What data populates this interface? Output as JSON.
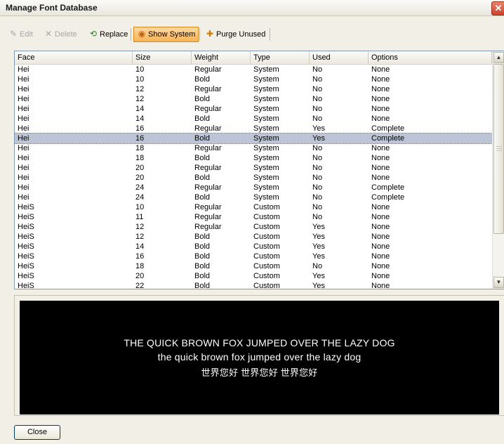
{
  "window": {
    "title": "Manage Font Database",
    "close_glyph": "✕"
  },
  "toolbar": {
    "edit": {
      "label": "Edit",
      "icon": "pencil-icon",
      "glyph": "✎"
    },
    "delete": {
      "label": "Delete",
      "icon": "x-icon",
      "glyph": "✕"
    },
    "replace": {
      "label": "Replace",
      "icon": "replace-icon",
      "glyph": "⟲"
    },
    "show_system": {
      "label": "Show System",
      "icon": "system-icon",
      "glyph": "◉"
    },
    "purge": {
      "label": "Purge Unused",
      "icon": "purge-icon",
      "glyph": "✚"
    }
  },
  "table": {
    "columns": [
      "Face",
      "Size",
      "Weight",
      "Type",
      "Used",
      "Options"
    ],
    "rows": [
      [
        "Hei",
        "10",
        "Regular",
        "System",
        "No",
        "None"
      ],
      [
        "Hei",
        "10",
        "Bold",
        "System",
        "No",
        "None"
      ],
      [
        "Hei",
        "12",
        "Regular",
        "System",
        "No",
        "None"
      ],
      [
        "Hei",
        "12",
        "Bold",
        "System",
        "No",
        "None"
      ],
      [
        "Hei",
        "14",
        "Regular",
        "System",
        "No",
        "None"
      ],
      [
        "Hei",
        "14",
        "Bold",
        "System",
        "No",
        "None"
      ],
      [
        "Hei",
        "16",
        "Regular",
        "System",
        "Yes",
        "Complete"
      ],
      [
        "Hei",
        "16",
        "Bold",
        "System",
        "Yes",
        "Complete"
      ],
      [
        "Hei",
        "18",
        "Regular",
        "System",
        "No",
        "None"
      ],
      [
        "Hei",
        "18",
        "Bold",
        "System",
        "No",
        "None"
      ],
      [
        "Hei",
        "20",
        "Regular",
        "System",
        "No",
        "None"
      ],
      [
        "Hei",
        "20",
        "Bold",
        "System",
        "No",
        "None"
      ],
      [
        "Hei",
        "24",
        "Regular",
        "System",
        "No",
        "Complete"
      ],
      [
        "Hei",
        "24",
        "Bold",
        "System",
        "No",
        "Complete"
      ],
      [
        "HeiS",
        "10",
        "Regular",
        "Custom",
        "No",
        "None"
      ],
      [
        "HeiS",
        "11",
        "Regular",
        "Custom",
        "No",
        "None"
      ],
      [
        "HeiS",
        "12",
        "Regular",
        "Custom",
        "Yes",
        "None"
      ],
      [
        "HeiS",
        "12",
        "Bold",
        "Custom",
        "Yes",
        "None"
      ],
      [
        "HeiS",
        "14",
        "Bold",
        "Custom",
        "Yes",
        "None"
      ],
      [
        "HeiS",
        "16",
        "Bold",
        "Custom",
        "Yes",
        "None"
      ],
      [
        "HeiS",
        "18",
        "Bold",
        "Custom",
        "No",
        "None"
      ],
      [
        "HeiS",
        "20",
        "Bold",
        "Custom",
        "Yes",
        "None"
      ],
      [
        "HeiS",
        "22",
        "Bold",
        "Custom",
        "Yes",
        "None"
      ]
    ],
    "selected_row": 7
  },
  "preview": {
    "line1": "THE QUICK BROWN FOX JUMPED OVER THE LAZY DOG",
    "line2": "the quick brown fox jumped over the lazy dog",
    "line3": "世界您好 世界您好 世界您好"
  },
  "footer": {
    "close_label": "Close"
  },
  "colors": {
    "selection": "#bcc4d6",
    "active_button": "#f7b457",
    "preview_bg": "#000000"
  }
}
